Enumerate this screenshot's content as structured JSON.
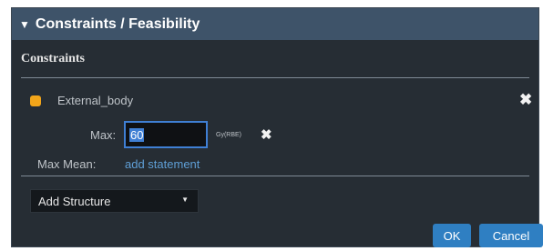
{
  "panel": {
    "title": "Constraints / Feasibility",
    "expanded_icon": "caret-down-icon"
  },
  "constraints": {
    "section_title": "Constraints",
    "structure": {
      "color": "#f2a51a",
      "name": "External_body",
      "max_label": "Max:",
      "max_value": "60",
      "unit": "Gy(RBE)",
      "max_mean_label": "Max Mean:",
      "add_statement_link": "add statement"
    }
  },
  "add_structure": {
    "selected": "Add Structure"
  },
  "buttons": {
    "ok": "OK",
    "cancel": "Cancel"
  },
  "colors": {
    "header_bg": "#3e5369",
    "panel_bg": "#262d34",
    "accent": "#2f7fc2",
    "link": "#5f9fd6"
  }
}
